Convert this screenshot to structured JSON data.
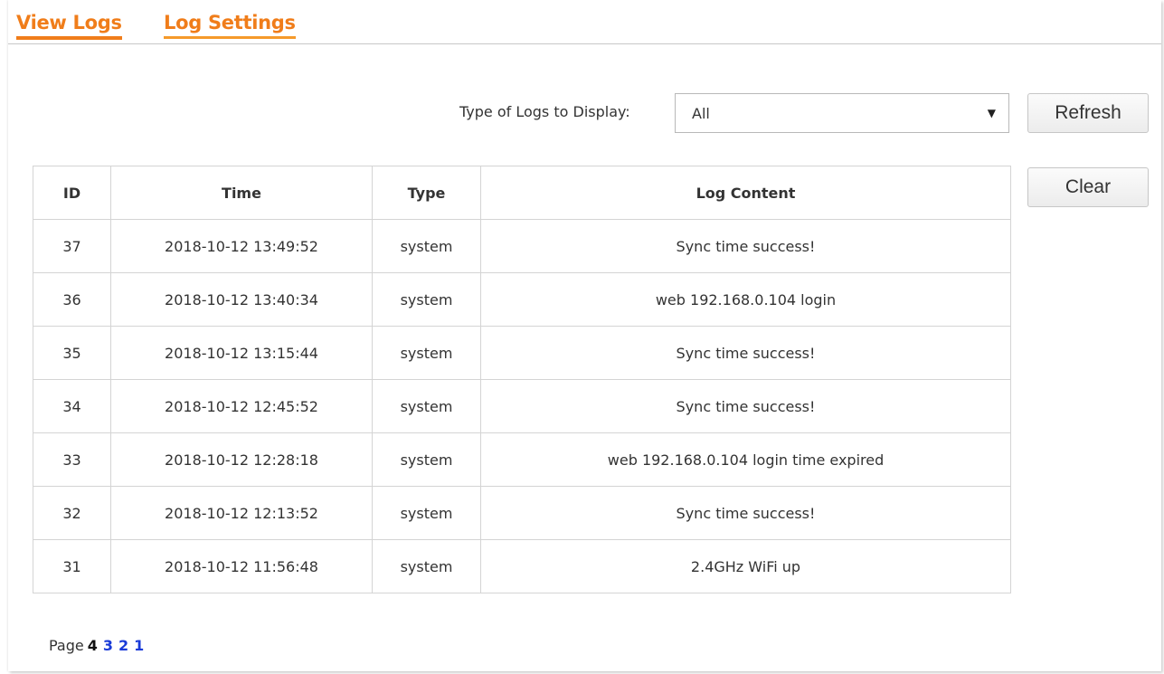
{
  "tabs": [
    {
      "label": "View Logs",
      "active": true
    },
    {
      "label": "Log Settings",
      "active": false
    }
  ],
  "filter": {
    "label": "Type of Logs to Display:",
    "selected": "All"
  },
  "buttons": {
    "refresh": "Refresh",
    "clear": "Clear"
  },
  "table": {
    "headers": [
      "ID",
      "Time",
      "Type",
      "Log Content"
    ],
    "rows": [
      [
        "37",
        "2018-10-12 13:49:52",
        "system",
        "Sync time success!"
      ],
      [
        "36",
        "2018-10-12 13:40:34",
        "system",
        "web 192.168.0.104 login"
      ],
      [
        "35",
        "2018-10-12 13:15:44",
        "system",
        "Sync time success!"
      ],
      [
        "34",
        "2018-10-12 12:45:52",
        "system",
        "Sync time success!"
      ],
      [
        "33",
        "2018-10-12 12:28:18",
        "system",
        "web 192.168.0.104 login time expired"
      ],
      [
        "32",
        "2018-10-12 12:13:52",
        "system",
        "Sync time success!"
      ],
      [
        "31",
        "2018-10-12 11:56:48",
        "system",
        "2.4GHz WiFi up"
      ]
    ]
  },
  "pagination": {
    "label": "Page",
    "current": "4",
    "pages": [
      "3",
      "2",
      "1"
    ]
  },
  "colors": {
    "tab_accent": "#f07d1a",
    "page_link": "#1a3bd8"
  }
}
